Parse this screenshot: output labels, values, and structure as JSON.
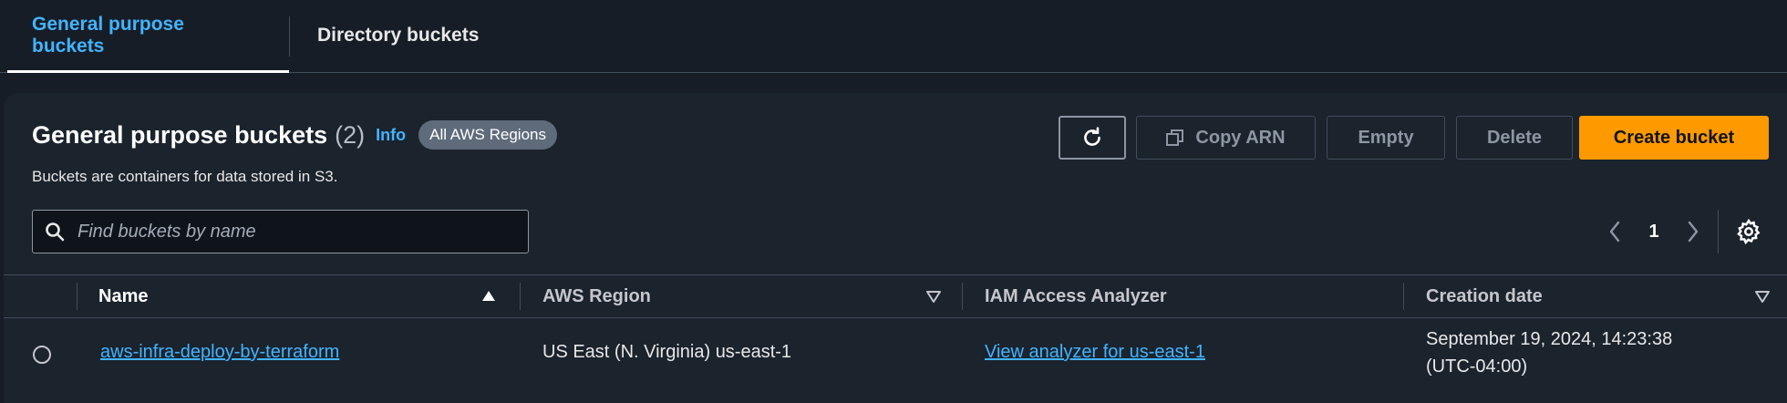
{
  "tabs": [
    {
      "label": "General purpose buckets",
      "active": true
    },
    {
      "label": "Directory buckets",
      "active": false
    }
  ],
  "panel": {
    "title": "General purpose buckets",
    "count": "(2)",
    "info": "Info",
    "region_badge": "All AWS Regions",
    "subtitle": "Buckets are containers for data stored in S3."
  },
  "actions": {
    "refresh_icon": "refresh-icon",
    "copy_arn": "Copy ARN",
    "empty": "Empty",
    "delete": "Delete",
    "create": "Create bucket"
  },
  "search": {
    "placeholder": "Find buckets by name",
    "value": ""
  },
  "pagination": {
    "current_page": "1"
  },
  "table": {
    "columns": [
      "Name",
      "AWS Region",
      "IAM Access Analyzer",
      "Creation date"
    ],
    "rows": [
      {
        "name": "aws-infra-deploy-by-terraform",
        "region": "US East (N. Virginia) us-east-1",
        "analyzer": "View analyzer for us-east-1",
        "created_line1": "September 19, 2024, 14:23:38",
        "created_line2": "(UTC-04:00)"
      }
    ]
  },
  "colors": {
    "accent": "#42b4ff",
    "primary_button": "#ff9900",
    "background": "#161d26",
    "panel": "#1b232d"
  }
}
